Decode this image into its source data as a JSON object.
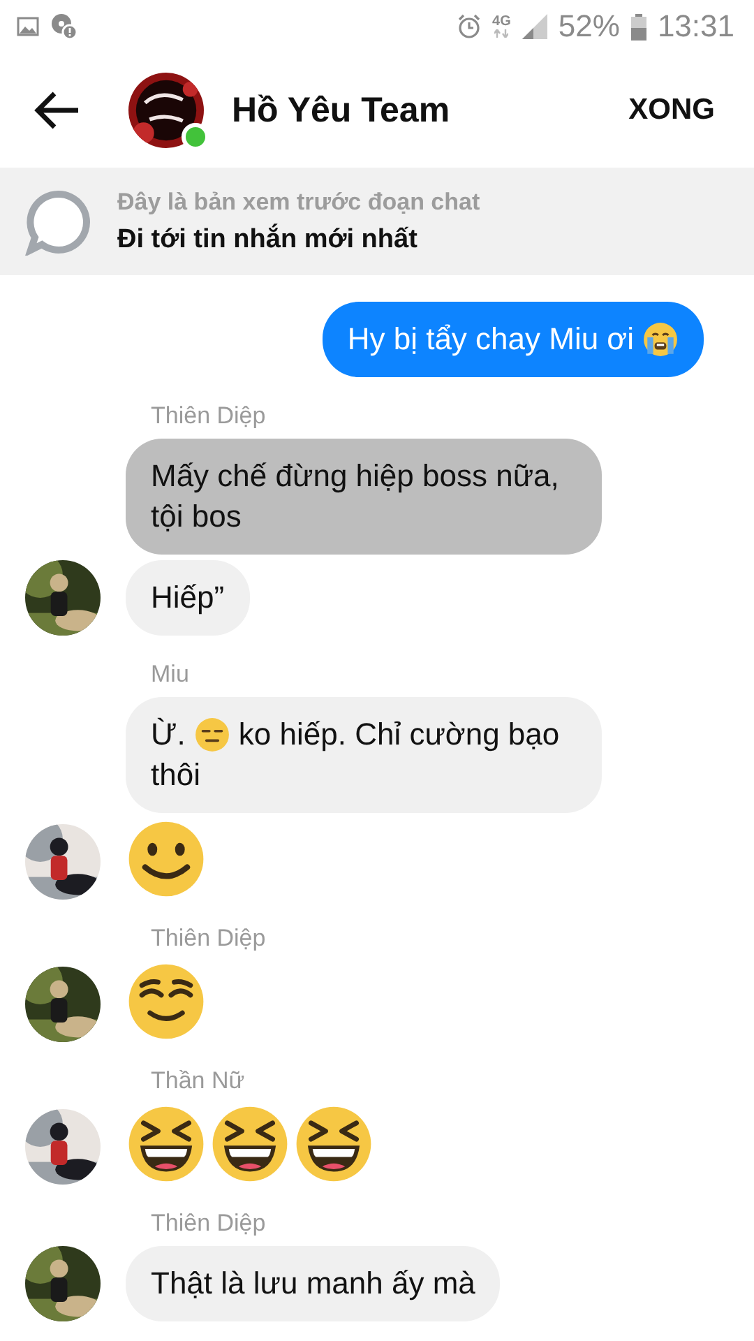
{
  "status_bar": {
    "network": "4G",
    "battery": "52%",
    "time": "13:31"
  },
  "header": {
    "title": "Hồ Yêu Team",
    "online": true,
    "action": "XONG"
  },
  "preview_banner": {
    "notice": "Đây là bản xem trước đoạn chat",
    "link": "Đi tới tin nhắn mới nhất"
  },
  "groups": [
    {
      "kind": "outgoing",
      "bubbles": [
        {
          "kind": "text",
          "highlighted": false,
          "parts": [
            {
              "kind": "text",
              "text": "Hy bị tẩy chay Miu ơi"
            },
            {
              "kind": "crying"
            }
          ]
        }
      ]
    },
    {
      "kind": "incoming",
      "sender": "Thiên Diệp",
      "bubbles": [
        {
          "kind": "text",
          "highlighted": true,
          "parts": [
            {
              "kind": "text",
              "text": "Mấy chế đừng hiệp boss nữa, tội bos"
            }
          ]
        },
        {
          "kind": "text",
          "highlighted": false,
          "parts": [
            {
              "kind": "text",
              "text": "Hiếp”"
            }
          ]
        }
      ]
    },
    {
      "kind": "incoming",
      "sender": "Miu",
      "bubbles": [
        {
          "kind": "text",
          "highlighted": false,
          "parts": [
            {
              "kind": "text",
              "text": "Ừ."
            },
            {
              "kind": "neutral"
            },
            {
              "kind": "text",
              "text": "ko hiếp. Chỉ cường bạo"
            },
            {
              "kind": "text",
              "text": "thôi"
            }
          ]
        },
        {
          "kind": "emoji",
          "faces": [
            {
              "kind": "smile"
            }
          ]
        }
      ]
    },
    {
      "kind": "incoming",
      "sender": "Thiên Diệp",
      "bubbles": [
        {
          "kind": "emoji",
          "faces": [
            {
              "kind": "relieved"
            }
          ]
        }
      ]
    },
    {
      "kind": "incoming",
      "sender": "Thần Nữ",
      "bubbles": [
        {
          "kind": "emoji",
          "faces": [
            {
              "kind": "laugh"
            },
            {
              "kind": "laugh"
            },
            {
              "kind": "laugh"
            }
          ]
        }
      ]
    },
    {
      "kind": "incoming",
      "sender": "Thiên Diệp",
      "bubbles": [
        {
          "kind": "text",
          "highlighted": false,
          "parts": [
            {
              "kind": "text",
              "text": "Thật là lưu manh ấy mà"
            }
          ]
        }
      ]
    }
  ]
}
